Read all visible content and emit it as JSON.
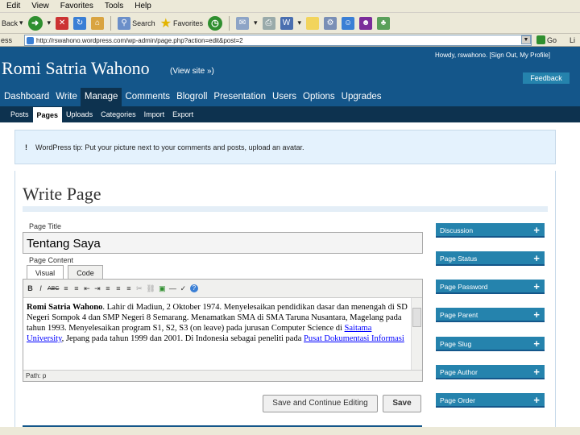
{
  "browser": {
    "menu": [
      "Edit",
      "View",
      "Favorites",
      "Tools",
      "Help"
    ],
    "toolbar": {
      "back": "Back",
      "search": "Search",
      "favorites": "Favorites"
    },
    "address_label": "ess",
    "url": "http://rswahono.wordpress.com/wp-admin/page.php?action=edit&post=2",
    "go": "Go",
    "links": "Li"
  },
  "header": {
    "blog_title": "Romi Satria Wahono",
    "view_site": "(View site »)",
    "howdy": "Howdy, rswahono. [Sign Out, My Profile]",
    "feedback": "Feedback"
  },
  "admin_menu": [
    "Dashboard",
    "Write",
    "Manage",
    "Comments",
    "Blogroll",
    "Presentation",
    "Users",
    "Options",
    "Upgrades"
  ],
  "admin_menu_active": "Manage",
  "sub_menu": [
    "Posts",
    "Pages",
    "Uploads",
    "Categories",
    "Import",
    "Export"
  ],
  "sub_menu_active": "Pages",
  "tip": {
    "mark": "!",
    "text": "WordPress tip: Put your picture next to your comments and posts, upload an avatar."
  },
  "page": {
    "heading": "Write Page",
    "title_label": "Page Title",
    "title_value": "Tentang Saya",
    "content_label": "Page Content",
    "tabs": [
      "Visual",
      "Code"
    ],
    "active_tab": "Visual",
    "editor_tools": [
      "B",
      "I",
      "ABC",
      "≡",
      "≡",
      "⇤",
      "⇥",
      "≡",
      "≡",
      "≡",
      "✂",
      "⛓",
      "▣",
      "―",
      "✓",
      "?"
    ],
    "content_name": "Romi Satria Wahono",
    "content_1": ". Lahir di Madiun, 2 Oktober 1974. Menyelesaikan pendidikan dasar dan menengah di SD Negeri Sompok 4 dan SMP Negeri 8 Semarang. Menamatkan SMA di SMA Taruna Nusantara, Magelang pada tahun 1993. Menyelesaikan program S1, S2, S3 (on leave) pada jurusan Computer Science di ",
    "content_link_1": "Saitama University",
    "content_2": ", Jepang pada tahun 1999 dan 2001. Di Indonesia sebagai peneliti pada ",
    "content_link_2": "Pusat Dokumentasi Informasi",
    "path": "Path: p",
    "save_continue": "Save and Continue Editing",
    "save": "Save"
  },
  "sidebar": [
    "Discussion",
    "Page Status",
    "Page Password",
    "Page Parent",
    "Page Slug",
    "Page Author",
    "Page Order"
  ]
}
